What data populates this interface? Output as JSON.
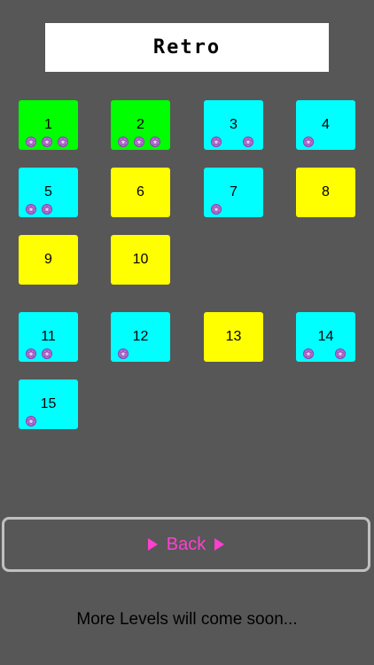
{
  "header": {
    "title": "Retro"
  },
  "colors": {
    "completed": "#00ff00",
    "played": "#00ffff",
    "unplayed": "#ffff00",
    "accent": "#ff3fd0",
    "star": "#b56fd2"
  },
  "levels": [
    {
      "number": "1",
      "status": "completed",
      "stars": 3
    },
    {
      "number": "2",
      "status": "completed",
      "stars": 3
    },
    {
      "number": "3",
      "status": "played",
      "stars": 2
    },
    {
      "number": "4",
      "status": "played",
      "stars": 1
    },
    {
      "number": "5",
      "status": "played",
      "stars": 2
    },
    {
      "number": "6",
      "status": "unplayed",
      "stars": 0
    },
    {
      "number": "7",
      "status": "played",
      "stars": 1
    },
    {
      "number": "8",
      "status": "unplayed",
      "stars": 0
    },
    {
      "number": "9",
      "status": "unplayed",
      "stars": 0
    },
    {
      "number": "10",
      "status": "unplayed",
      "stars": 0
    },
    {
      "number": "11",
      "status": "played",
      "stars": 2
    },
    {
      "number": "12",
      "status": "played",
      "stars": 1
    },
    {
      "number": "13",
      "status": "unplayed",
      "stars": 0
    },
    {
      "number": "14",
      "status": "played",
      "stars": 2
    },
    {
      "number": "15",
      "status": "played",
      "stars": 1
    }
  ],
  "back_button": {
    "label": "Back",
    "icon": "play-triangle-icon"
  },
  "footer": {
    "message": "More Levels will come soon..."
  }
}
